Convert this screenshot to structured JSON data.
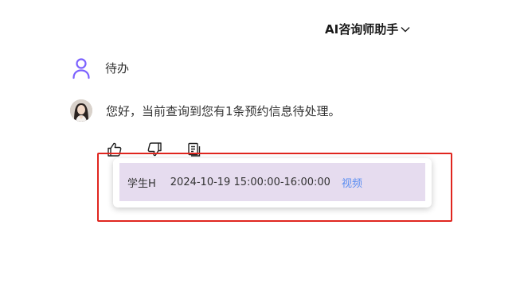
{
  "header": {
    "title": "AI咨询师助手",
    "dropdown_icon": "chevron-down-icon"
  },
  "user_message": {
    "icon": "user-icon",
    "text": "待办",
    "accent": "#7b61ff"
  },
  "bot_message": {
    "avatar": "avatar",
    "text": "您好，当前查询到您有1条预约信息待处理。",
    "actions": [
      "thumbs-up-icon",
      "thumbs-down-icon",
      "copy-icon"
    ]
  },
  "appointments": [
    {
      "student": "学生H",
      "time": "2024-10-19 15:00:00-16:00:00",
      "type": "视频"
    }
  ],
  "colors": {
    "highlight": "#e0261f",
    "row_bg": "#e6dcef",
    "link": "#5b8ef0"
  }
}
